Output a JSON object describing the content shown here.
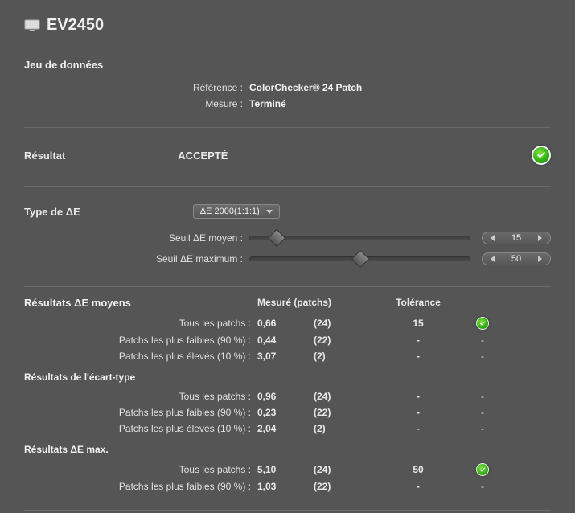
{
  "title": "EV2450",
  "dataset": {
    "heading": "Jeu de données",
    "reference_label": "Référence :",
    "reference_value": "ColorChecker® 24 Patch",
    "measure_label": "Mesure :",
    "measure_value": "Terminé"
  },
  "result": {
    "label": "Résultat",
    "value": "ACCEPTÉ"
  },
  "deltaE": {
    "heading": "Type de ΔE",
    "selected": "ΔE 2000(1:1:1)",
    "avg_threshold_label": "Seuil ΔE moyen :",
    "avg_threshold_value": "15",
    "avg_threshold_pct": 12,
    "max_threshold_label": "Seuil ΔE maximum :",
    "max_threshold_value": "50",
    "max_threshold_pct": 50
  },
  "results": {
    "avg_heading": "Résultats ΔE moyens",
    "col_measured": "Mesuré (patchs)",
    "col_tolerance": "Tolérance",
    "avg_rows": [
      {
        "label": "Tous les patchs :",
        "measured": "0,66",
        "patches": "(24)",
        "tolerance": "15",
        "check": true
      },
      {
        "label": "Patchs les plus faibles (90 %) :",
        "measured": "0,44",
        "patches": "(22)",
        "tolerance": "-",
        "check": false
      },
      {
        "label": "Patchs les plus élevés (10 %) :",
        "measured": "3,07",
        "patches": "(2)",
        "tolerance": "-",
        "check": false
      }
    ],
    "std_heading": "Résultats de l'écart-type",
    "std_rows": [
      {
        "label": "Tous les patchs :",
        "measured": "0,96",
        "patches": "(24)",
        "tolerance": "-",
        "check": false
      },
      {
        "label": "Patchs les plus faibles (90 %) :",
        "measured": "0,23",
        "patches": "(22)",
        "tolerance": "-",
        "check": false
      },
      {
        "label": "Patchs les plus élevés (10 %) :",
        "measured": "2,04",
        "patches": "(2)",
        "tolerance": "-",
        "check": false
      }
    ],
    "max_heading": "Résultats ΔE max.",
    "max_rows": [
      {
        "label": "Tous les patchs :",
        "measured": "5,10",
        "patches": "(24)",
        "tolerance": "50",
        "check": true
      },
      {
        "label": "Patchs les plus faibles (90 %) :",
        "measured": "1,03",
        "patches": "(22)",
        "tolerance": "-",
        "check": false
      }
    ]
  }
}
